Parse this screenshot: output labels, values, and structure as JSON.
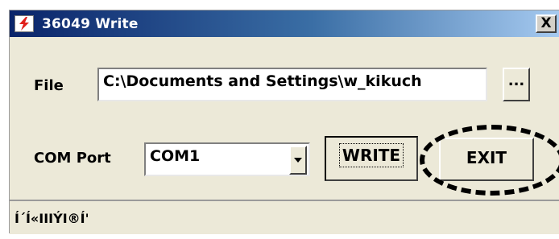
{
  "window": {
    "title": "36049 Write",
    "close_label": "X"
  },
  "file": {
    "label": "File",
    "value": "C:\\Documents and Settings\\w_kikuch",
    "browse_label": "..."
  },
  "com": {
    "label": "COM Port",
    "selected": "COM1"
  },
  "buttons": {
    "write": "WRITE",
    "exit": "EXIT"
  },
  "status": {
    "text": "Í´Í«IIIÝI®Í'"
  },
  "colors": {
    "title_start": "#0a246a",
    "title_end": "#a6caf0",
    "window_bg": "#ece9d8",
    "icon_red": "#e0201c"
  }
}
